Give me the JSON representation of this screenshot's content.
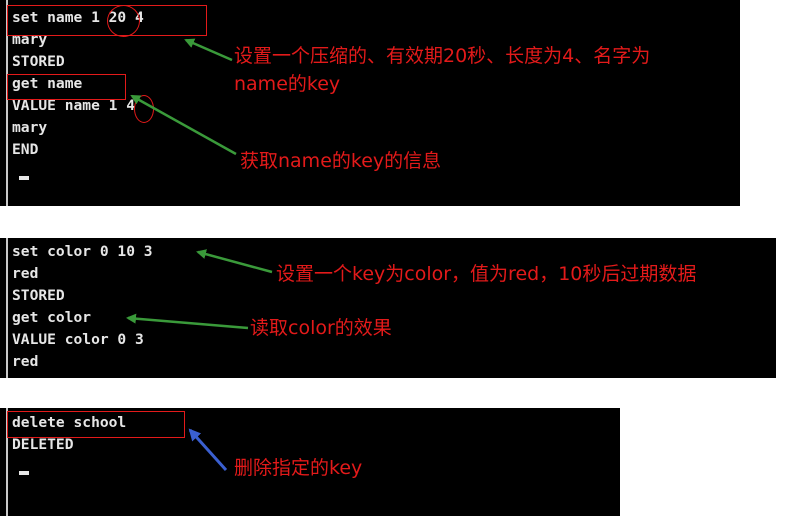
{
  "panel1": {
    "lines": [
      "set name 1 20 4",
      "mary",
      "STORED",
      "get name",
      "VALUE name 1 4",
      "mary",
      "END"
    ],
    "note1_line1": "设置一个压缩的、有效期20秒、长度为4、名字为",
    "note1_line2": "name的key",
    "note2": "获取name的key的信息"
  },
  "panel2": {
    "lines": [
      "set color 0 10 3",
      "red",
      "STORED",
      "get color",
      "VALUE color 0 3",
      "red"
    ],
    "note1": "设置一个key为color，值为red，10秒后过期数据",
    "note2": "读取color的效果"
  },
  "panel3": {
    "lines": [
      "delete school",
      "DELETED"
    ],
    "note1": "删除指定的key"
  },
  "colors": {
    "terminal_bg": "#000000",
    "terminal_text": "#e6e6e6",
    "annotation_red": "#e31a1a",
    "arrow_green": "#3a9a3a",
    "arrow_blue": "#3a5fd0"
  }
}
